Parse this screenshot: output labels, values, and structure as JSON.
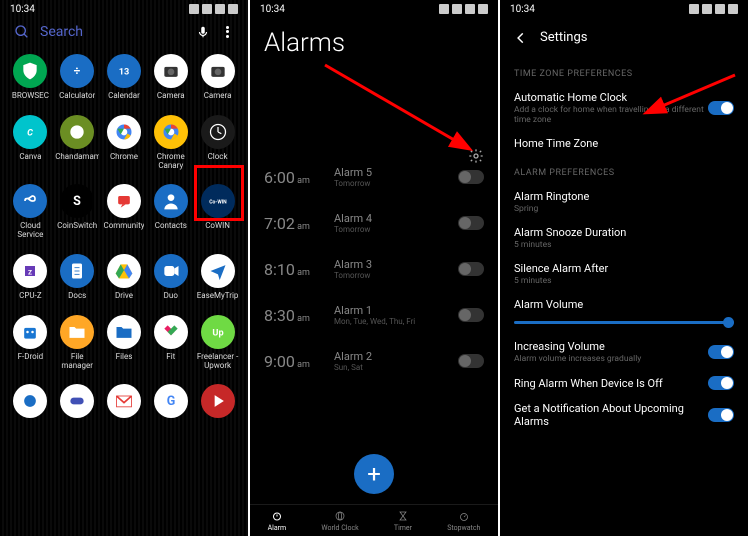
{
  "status": {
    "time": "10:34",
    "icons": [
      "M",
      "cloud"
    ]
  },
  "screen1": {
    "search_placeholder": "Search",
    "apps": [
      {
        "label": "BROWSEC",
        "bg": "#00a651",
        "fg": "#fff",
        "glyph": "shield"
      },
      {
        "label": "Calculator",
        "bg": "#1a6dc4",
        "fg": "#fff",
        "glyph": "calc"
      },
      {
        "label": "Calendar",
        "bg": "#1a6dc4",
        "fg": "#fff",
        "glyph": "13"
      },
      {
        "label": "Camera",
        "bg": "#fff",
        "fg": "#000",
        "glyph": "camera"
      },
      {
        "label": "Camera",
        "bg": "#fff",
        "fg": "#000",
        "glyph": "camera"
      },
      {
        "label": "Canva",
        "bg": "#00c4cc",
        "fg": "#fff",
        "glyph": "canva"
      },
      {
        "label": "Chandamama",
        "bg": "#6b8e23",
        "fg": "#fff",
        "glyph": "moon"
      },
      {
        "label": "Chrome",
        "bg": "#fff",
        "fg": "#fff",
        "glyph": "chrome"
      },
      {
        "label": "Chrome Canary",
        "bg": "#ffc107",
        "fg": "#fff",
        "glyph": "chrome"
      },
      {
        "label": "Clock",
        "bg": "#1a1a1a",
        "fg": "#fff",
        "glyph": "clock"
      },
      {
        "label": "Cloud Service",
        "bg": "#1a6dc4",
        "fg": "#fff",
        "glyph": "infinity"
      },
      {
        "label": "CoinSwitch",
        "bg": "#000",
        "fg": "#fff",
        "glyph": "S"
      },
      {
        "label": "Community",
        "bg": "#fff",
        "fg": "#e53935",
        "glyph": "chat"
      },
      {
        "label": "Contacts",
        "bg": "#1a6dc4",
        "fg": "#fff",
        "glyph": "person"
      },
      {
        "label": "CoWIN",
        "bg": "#002b5c",
        "fg": "#fff",
        "glyph": "cowin"
      },
      {
        "label": "CPU-Z",
        "bg": "#fff",
        "fg": "#673ab7",
        "glyph": "cpu"
      },
      {
        "label": "Docs",
        "bg": "#1a6dc4",
        "fg": "#fff",
        "glyph": "doc"
      },
      {
        "label": "Drive",
        "bg": "#fff",
        "fg": "#fff",
        "glyph": "drive"
      },
      {
        "label": "Duo",
        "bg": "#1a6dc4",
        "fg": "#fff",
        "glyph": "duo"
      },
      {
        "label": "EaseMyTrip",
        "bg": "#fff",
        "fg": "#1a6dc4",
        "glyph": "plane"
      },
      {
        "label": "F-Droid",
        "bg": "#fff",
        "fg": "#1976d2",
        "glyph": "fdroid"
      },
      {
        "label": "File manager",
        "bg": "#ffa726",
        "fg": "#fff",
        "glyph": "folder"
      },
      {
        "label": "Files",
        "bg": "#fff",
        "fg": "#1a6dc4",
        "glyph": "folder"
      },
      {
        "label": "Fit",
        "bg": "#fff",
        "fg": "#e91e63",
        "glyph": "fit"
      },
      {
        "label": "Freelancer - Upwork",
        "bg": "#6fda44",
        "fg": "#fff",
        "glyph": "up"
      },
      {
        "label": "",
        "bg": "#fff",
        "fg": "#1a6dc4",
        "glyph": "g"
      },
      {
        "label": "",
        "bg": "#fff",
        "fg": "#4050b5",
        "glyph": "game"
      },
      {
        "label": "",
        "bg": "#fff",
        "fg": "#e53935",
        "glyph": "gmail"
      },
      {
        "label": "",
        "bg": "#fff",
        "fg": "#4285f4",
        "glyph": "G"
      },
      {
        "label": "",
        "bg": "#c62828",
        "fg": "#fff",
        "glyph": "play"
      }
    ]
  },
  "screen2": {
    "title": "Alarms",
    "alarms": [
      {
        "time": "6:00",
        "period": "am",
        "name": "Alarm 5",
        "days": "Tomorrow",
        "on": false
      },
      {
        "time": "7:02",
        "period": "am",
        "name": "Alarm 4",
        "days": "Tomorrow",
        "on": false
      },
      {
        "time": "8:10",
        "period": "am",
        "name": "Alarm 3",
        "days": "Tomorrow",
        "on": false
      },
      {
        "time": "8:30",
        "period": "am",
        "name": "Alarm 1",
        "days": "Mon, Tue, Wed, Thu, Fri",
        "on": false
      },
      {
        "time": "9:00",
        "period": "am",
        "name": "Alarm 2",
        "days": "Sun, Sat",
        "on": false
      }
    ],
    "nav": [
      {
        "label": "Alarm",
        "active": true
      },
      {
        "label": "World Clock",
        "active": false
      },
      {
        "label": "Timer",
        "active": false
      },
      {
        "label": "Stopwatch",
        "active": false
      }
    ]
  },
  "screen3": {
    "header": "Settings",
    "section1_title": "TIME ZONE PREFERENCES",
    "auto_clock": {
      "title": "Automatic Home Clock",
      "sub": "Add a clock for home when travelling to a different time zone",
      "on": true
    },
    "home_tz": "Home Time Zone",
    "section2_title": "ALARM PREFERENCES",
    "ringtone": {
      "title": "Alarm Ringtone",
      "sub": "Spring"
    },
    "snooze": {
      "title": "Alarm Snooze Duration",
      "sub": "5 minutes"
    },
    "silence": {
      "title": "Silence Alarm After",
      "sub": "5 minutes"
    },
    "volume": "Alarm Volume",
    "increasing": {
      "title": "Increasing Volume",
      "sub": "Alarm volume increases gradually",
      "on": true
    },
    "ring_off": {
      "title": "Ring Alarm When Device Is Off",
      "on": true
    },
    "notification": {
      "title": "Get a Notification About Upcoming Alarms",
      "on": true
    }
  }
}
